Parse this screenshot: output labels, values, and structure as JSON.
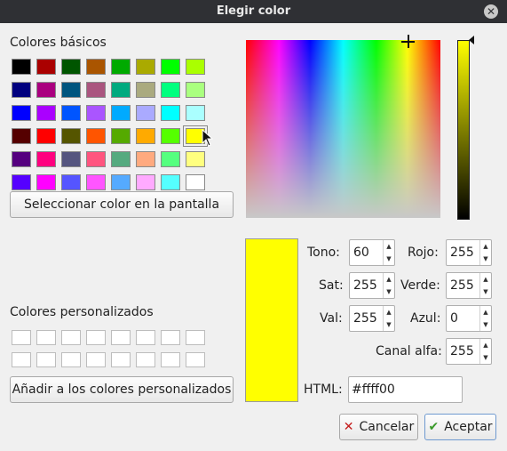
{
  "window": {
    "title": "Elegir color"
  },
  "basic_colors": {
    "title": "Colores básicos",
    "selected_index": 31,
    "swatches": [
      "#000000",
      "#aa0000",
      "#005500",
      "#aa5500",
      "#00aa00",
      "#aaaa00",
      "#00ff00",
      "#aaff00",
      "#00007f",
      "#aa007f",
      "#00557f",
      "#aa557f",
      "#00aa7f",
      "#aaaa7f",
      "#00ff7f",
      "#aaff7f",
      "#0000ff",
      "#aa00ff",
      "#0055ff",
      "#aa55ff",
      "#00aaff",
      "#aaaaff",
      "#00ffff",
      "#aaffff",
      "#550000",
      "#ff0000",
      "#555500",
      "#ff5500",
      "#55aa00",
      "#ffaa00",
      "#55ff00",
      "#ffff00",
      "#55007f",
      "#ff007f",
      "#55557f",
      "#ff557f",
      "#55aa7f",
      "#ffaa7f",
      "#55ff7f",
      "#ffff7f",
      "#5500ff",
      "#ff00ff",
      "#5555ff",
      "#ff55ff",
      "#55aaff",
      "#ffaaff",
      "#55ffff",
      "#ffffff"
    ]
  },
  "screen_pick_button": {
    "label": "Seleccionar color en la pantalla"
  },
  "custom_colors": {
    "title": "Colores personalizados",
    "count": 16,
    "add_button": "Añadir a los colores personalizados"
  },
  "current_color": "#ffff00",
  "fields": {
    "hue": {
      "label": "Tono:",
      "value": "60"
    },
    "sat": {
      "label": "Sat:",
      "value": "255"
    },
    "val": {
      "label": "Val:",
      "value": "255"
    },
    "red": {
      "label": "Rojo:",
      "value": "255"
    },
    "green": {
      "label": "Verde:",
      "value": "255"
    },
    "blue": {
      "label": "Azul:",
      "value": "0"
    },
    "alpha": {
      "label": "Canal alfa:",
      "value": "255"
    },
    "html": {
      "label": "HTML:",
      "value": "#ffff00"
    }
  },
  "buttons": {
    "cancel": "Cancelar",
    "accept": "Aceptar"
  }
}
